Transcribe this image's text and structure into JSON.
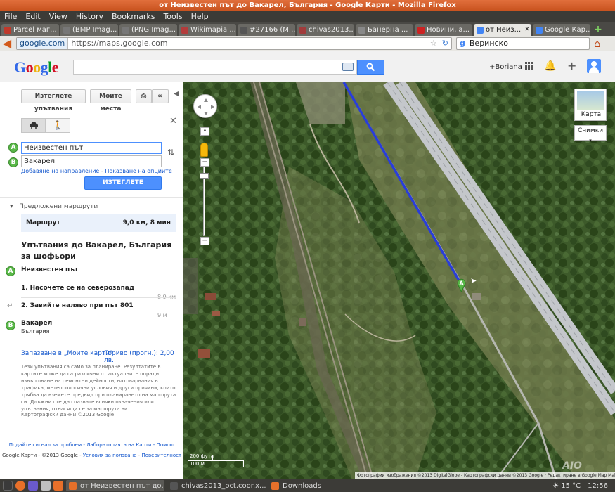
{
  "window": {
    "title": "от Неизвестен път до Вакарел, България - Google Карти - Mozilla Firefox"
  },
  "menu": [
    "File",
    "Edit",
    "View",
    "History",
    "Bookmarks",
    "Tools",
    "Help"
  ],
  "tabs": [
    {
      "label": "Parcel маг...",
      "color": "#c0392b"
    },
    {
      "label": "(BMP Imag...",
      "color": "#777777"
    },
    {
      "label": "(PNG Imag...",
      "color": "#777777"
    },
    {
      "label": "Wikimapia ...",
      "color": "#b33b3b"
    },
    {
      "label": "#27166 (M...",
      "color": "#555555"
    },
    {
      "label": "chivas2013...",
      "color": "#a13b3b"
    },
    {
      "label": "Банерна ...",
      "color": "#888888"
    },
    {
      "label": "Новини, а...",
      "color": "#cc2222"
    },
    {
      "label": "от Неиз...",
      "color": "#4285f4",
      "active": true
    },
    {
      "label": "Google Кар...",
      "color": "#4285f4"
    }
  ],
  "nav": {
    "site": "google.com",
    "url": "https://maps.google.com",
    "search_value": "Веринско"
  },
  "google": {
    "logo": [
      "G",
      "o",
      "o",
      "g",
      "l",
      "e"
    ],
    "user": "+Boriana"
  },
  "sidebar": {
    "btn_directions": "Изтеглете упътвания",
    "btn_my_places": "Моите места",
    "from": "Неизвестен път",
    "to": "Вакарел",
    "from_pin": "A",
    "to_pin": "B",
    "link_add": "Добавяне на направление",
    "link_options": "Показване на опциите",
    "get_directions": "ИЗТЕГЛЕТЕ УПЪТВАНИЯ",
    "suggested": "Предложени маршрути",
    "route_name": "Маршрут",
    "route_info": "9,0 км, 8 мин",
    "directions_title": "Упътвания до Вакарел, България за шофьори",
    "start_name": "Неизвестен път",
    "steps": [
      {
        "num": "1.",
        "text": "Насочете се на северозапад",
        "dist": "8,9 км"
      },
      {
        "num": "2.",
        "text_pre": "Завийте наляво при ",
        "text_bold": "път 801",
        "dist": "9 м"
      }
    ],
    "dest_name": "Вакарел",
    "dest_country": "България",
    "save_link": "Запазване в „Моите карти\"",
    "fuel_link": "Гориво (прогн.): 2,00 лв.",
    "disclaimer": "Тези упътвания са само за планиране. Резултатите в картите може да са различни от актуалните поради извършване на ремонтни дейности, натоварвания в трафика, метеорологични условия и други причини, които трябва да вземете предвид при планирането на маршрута си. Длъжни сте да спазвате всички означения или упътвания, отнасящи се за маршрута ви.",
    "map_data": "Картографски данни ©2013 Google",
    "footer_links": [
      "Подайте сигнал за проблем",
      "Лабораторията на Карти",
      "Помощ"
    ],
    "footer_brand": "Google Карти - ©2013 Google",
    "footer_terms": "Условия за ползване",
    "footer_privacy": "Поверителност"
  },
  "map": {
    "widget_label": "Карта",
    "layers_label": "Снимки",
    "scale_ft": "200 фута",
    "scale_m": "100 м",
    "attribution": "Фотографии изображения ©2013 DigitalGlobe - Картографски данни ©2013 Google · Редактиране в Google Map Maker · Подайте сигнал за проблем",
    "pin_label": "A",
    "watermark": "AIO",
    "colors": {
      "route": "#2a3ed8",
      "highway": "#b9bcc0",
      "vegetation": "#3e5a2b"
    }
  },
  "taskbar": {
    "items": [
      {
        "label": "от Неизвестен път до...",
        "color": "#e8702a",
        "active": true
      },
      {
        "label": "chivas2013_oct.coor.x...",
        "color": "#555555"
      },
      {
        "label": "Downloads",
        "color": "#e8702a"
      }
    ],
    "temperature": "15 °C",
    "time": "12:56"
  }
}
